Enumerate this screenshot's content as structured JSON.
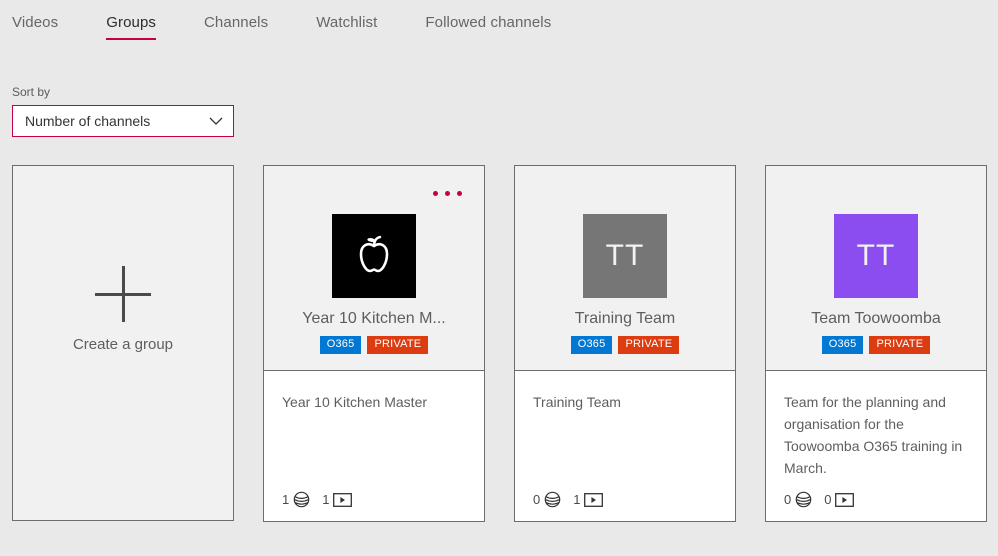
{
  "tabs": [
    {
      "label": "Videos",
      "active": false
    },
    {
      "label": "Groups",
      "active": true
    },
    {
      "label": "Channels",
      "active": false
    },
    {
      "label": "Watchlist",
      "active": false
    },
    {
      "label": "Followed channels",
      "active": false
    }
  ],
  "sort": {
    "label": "Sort by",
    "value": "Number of channels",
    "chevron_icon": "chevron-down-icon"
  },
  "create_card": {
    "label": "Create a group",
    "icon": "plus-icon"
  },
  "colors": {
    "accent": "#c4004b",
    "badge_o365": "#0078d4",
    "badge_private": "#dd3c10",
    "page_background": "#e9e9e9",
    "card_top_background": "#f1f1f1"
  },
  "cards": [
    {
      "name": "Year 10 Kitchen M...",
      "full_name": "Year 10 Kitchen Master",
      "description": "Year 10 Kitchen Master",
      "avatar": {
        "type": "image",
        "icon": "apple-icon",
        "background": "#000000"
      },
      "badges": [
        {
          "text": "O365",
          "style": "o365"
        },
        {
          "text": "PRIVATE",
          "style": "private"
        }
      ],
      "has_overflow_menu": true,
      "stats": {
        "channels": "1",
        "videos": "1",
        "channels_icon": "globe-icon",
        "videos_icon": "video-icon"
      }
    },
    {
      "name": "Training Team",
      "full_name": "Training Team",
      "description": "Training Team",
      "avatar": {
        "type": "initials",
        "initials": "TT",
        "background": "#767676"
      },
      "badges": [
        {
          "text": "O365",
          "style": "o365"
        },
        {
          "text": "PRIVATE",
          "style": "private"
        }
      ],
      "has_overflow_menu": false,
      "stats": {
        "channels": "0",
        "videos": "1",
        "channels_icon": "globe-icon",
        "videos_icon": "video-icon"
      }
    },
    {
      "name": "Team Toowoomba",
      "full_name": "Team Toowoomba",
      "description": "Team for the planning and organisation for the Toowoomba O365 training in March.",
      "avatar": {
        "type": "initials",
        "initials": "TT",
        "background": "#8b4df0"
      },
      "badges": [
        {
          "text": "O365",
          "style": "o365"
        },
        {
          "text": "PRIVATE",
          "style": "private"
        }
      ],
      "has_overflow_menu": false,
      "stats": {
        "channels": "0",
        "videos": "0",
        "channels_icon": "globe-icon",
        "videos_icon": "video-icon"
      }
    }
  ]
}
